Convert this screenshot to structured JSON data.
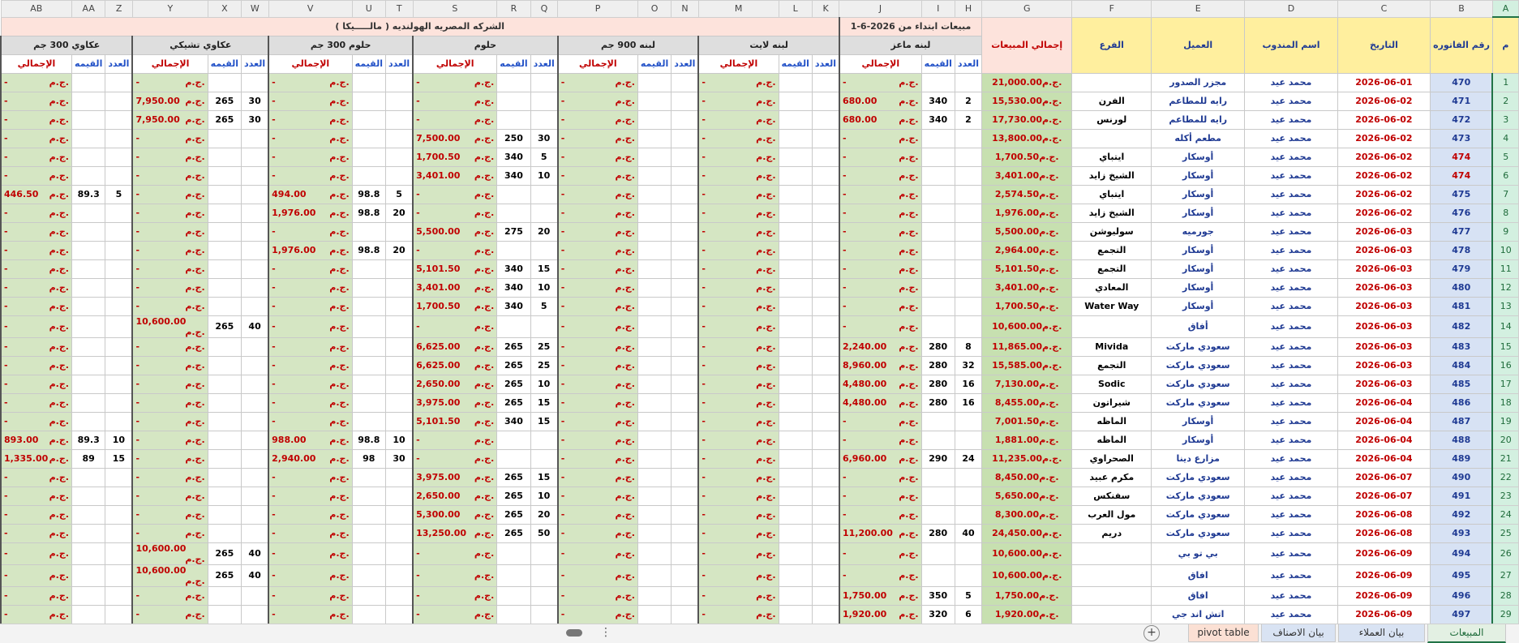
{
  "columns": [
    "AB",
    "AA",
    "Z",
    "Y",
    "X",
    "W",
    "V",
    "U",
    "T",
    "S",
    "R",
    "Q",
    "P",
    "O",
    "N",
    "M",
    "L",
    "K",
    "J",
    "I",
    "H",
    "G",
    "F",
    "E",
    "D",
    "C",
    "B",
    "A"
  ],
  "header": {
    "title": "الشركه المصريه الهولنديه ( مالـــــيكا )",
    "since": "مبيعات ابتداء من 2026-6-1",
    "total_sales": "إجمالي المبيعات",
    "branch": "الفرع",
    "customer": "العميل",
    "rep": "اسم المندوب",
    "date": "التاريخ",
    "invoice": "رقم الفاتوره",
    "num": "م",
    "products": [
      "عكاوي 300 جم",
      "عكاوي تشيكي",
      "حلوم 300 جم",
      "حلوم",
      "لبنه 900 جم",
      "لبنه لايت",
      "لبنه ماعز"
    ],
    "sub_total": "الإجمالي",
    "sub_price": "القيمه",
    "sub_count": "العدد"
  },
  "currency": "ج.م.",
  "dash": "-",
  "rows": [
    {
      "n": "1",
      "inv": "470",
      "date": "2026-06-01",
      "rep": "محمد عيد",
      "cust": "مجزر الصدور",
      "branch": "",
      "total": "21,000.00",
      "goat": [
        "",
        "",
        ""
      ],
      "light": [
        "",
        "",
        ""
      ],
      "l900": [
        "",
        "",
        ""
      ],
      "halloum": [
        "",
        "",
        ""
      ],
      "h300": [
        "",
        "",
        ""
      ],
      "czech": [
        "",
        "",
        ""
      ],
      "ak300": [
        "",
        "",
        ""
      ]
    },
    {
      "n": "2",
      "inv": "471",
      "date": "2026-06-02",
      "rep": "محمد عيد",
      "cust": "رايه للمطاعم",
      "branch": "الفرن",
      "total": "15,530.00",
      "goat": [
        "2",
        "340",
        "680.00"
      ],
      "light": [
        "",
        "",
        ""
      ],
      "l900": [
        "",
        "",
        ""
      ],
      "halloum": [
        "",
        "",
        ""
      ],
      "h300": [
        "",
        "",
        ""
      ],
      "czech": [
        "30",
        "265",
        "7,950.00"
      ],
      "ak300": [
        "",
        "",
        ""
      ]
    },
    {
      "n": "3",
      "inv": "472",
      "date": "2026-06-02",
      "rep": "محمد عيد",
      "cust": "رايه للمطاعم",
      "branch": "لورنس",
      "total": "17,730.00",
      "goat": [
        "2",
        "340",
        "680.00"
      ],
      "light": [
        "",
        "",
        ""
      ],
      "l900": [
        "",
        "",
        ""
      ],
      "halloum": [
        "",
        "",
        ""
      ],
      "h300": [
        "",
        "",
        ""
      ],
      "czech": [
        "30",
        "265",
        "7,950.00"
      ],
      "ak300": [
        "",
        "",
        ""
      ]
    },
    {
      "n": "4",
      "inv": "473",
      "date": "2026-06-02",
      "rep": "محمد عيد",
      "cust": "مطعم أكله",
      "branch": "",
      "total": "13,800.00",
      "goat": [
        "",
        "",
        ""
      ],
      "light": [
        "",
        "",
        ""
      ],
      "l900": [
        "",
        "",
        ""
      ],
      "halloum": [
        "30",
        "250",
        "7,500.00"
      ],
      "h300": [
        "",
        "",
        ""
      ],
      "czech": [
        "",
        "",
        ""
      ],
      "ak300": [
        "",
        "",
        ""
      ]
    },
    {
      "n": "5",
      "inv": "474",
      "date": "2026-06-02",
      "rep": "محمد عيد",
      "cust": "أوسكار",
      "branch": "ايتباي",
      "total": "1,700.50",
      "goat": [
        "",
        "",
        ""
      ],
      "light": [
        "",
        "",
        ""
      ],
      "l900": [
        "",
        "",
        ""
      ],
      "halloum": [
        "5",
        "340",
        "1,700.50"
      ],
      "h300": [
        "",
        "",
        ""
      ],
      "czech": [
        "",
        "",
        ""
      ],
      "ak300": [
        "",
        "",
        ""
      ]
    },
    {
      "n": "6",
      "inv": "474",
      "date": "2026-06-02",
      "rep": "محمد عيد",
      "cust": "أوسكار",
      "branch": "الشيخ زايد",
      "total": "3,401.00",
      "goat": [
        "",
        "",
        ""
      ],
      "light": [
        "",
        "",
        ""
      ],
      "l900": [
        "",
        "",
        ""
      ],
      "halloum": [
        "10",
        "340",
        "3,401.00"
      ],
      "h300": [
        "",
        "",
        ""
      ],
      "czech": [
        "",
        "",
        ""
      ],
      "ak300": [
        "",
        "",
        ""
      ]
    },
    {
      "n": "7",
      "inv": "475",
      "date": "2026-06-02",
      "rep": "محمد عيد",
      "cust": "أوسكار",
      "branch": "ايتباي",
      "total": "2,574.50",
      "goat": [
        "",
        "",
        ""
      ],
      "light": [
        "",
        "",
        ""
      ],
      "l900": [
        "",
        "",
        ""
      ],
      "halloum": [
        "",
        "",
        ""
      ],
      "h300": [
        "5",
        "98.8",
        "494.00"
      ],
      "czech": [
        "",
        "",
        ""
      ],
      "ak300": [
        "5",
        "89.3",
        "446.50"
      ]
    },
    {
      "n": "8",
      "inv": "476",
      "date": "2026-06-02",
      "rep": "محمد عيد",
      "cust": "أوسكار",
      "branch": "الشيخ زايد",
      "total": "1,976.00",
      "goat": [
        "",
        "",
        ""
      ],
      "light": [
        "",
        "",
        ""
      ],
      "l900": [
        "",
        "",
        ""
      ],
      "halloum": [
        "",
        "",
        ""
      ],
      "h300": [
        "20",
        "98.8",
        "1,976.00"
      ],
      "czech": [
        "",
        "",
        ""
      ],
      "ak300": [
        "",
        "",
        ""
      ]
    },
    {
      "n": "9",
      "inv": "477",
      "date": "2026-06-03",
      "rep": "محمد عيد",
      "cust": "جورميه",
      "branch": "سوليوشن",
      "total": "5,500.00",
      "goat": [
        "",
        "",
        ""
      ],
      "light": [
        "",
        "",
        ""
      ],
      "l900": [
        "",
        "",
        ""
      ],
      "halloum": [
        "20",
        "275",
        "5,500.00"
      ],
      "h300": [
        "",
        "",
        ""
      ],
      "czech": [
        "",
        "",
        ""
      ],
      "ak300": [
        "",
        "",
        ""
      ]
    },
    {
      "n": "10",
      "inv": "478",
      "date": "2026-06-03",
      "rep": "محمد عيد",
      "cust": "أوسكار",
      "branch": "التجمع",
      "total": "2,964.00",
      "goat": [
        "",
        "",
        ""
      ],
      "light": [
        "",
        "",
        ""
      ],
      "l900": [
        "",
        "",
        ""
      ],
      "halloum": [
        "",
        "",
        ""
      ],
      "h300": [
        "20",
        "98.8",
        "1,976.00"
      ],
      "czech": [
        "",
        "",
        ""
      ],
      "ak300": [
        "",
        "",
        ""
      ]
    },
    {
      "n": "11",
      "inv": "479",
      "date": "2026-06-03",
      "rep": "محمد عيد",
      "cust": "أوسكار",
      "branch": "التجمع",
      "total": "5,101.50",
      "goat": [
        "",
        "",
        ""
      ],
      "light": [
        "",
        "",
        ""
      ],
      "l900": [
        "",
        "",
        ""
      ],
      "halloum": [
        "15",
        "340",
        "5,101.50"
      ],
      "h300": [
        "",
        "",
        ""
      ],
      "czech": [
        "",
        "",
        ""
      ],
      "ak300": [
        "",
        "",
        ""
      ]
    },
    {
      "n": "12",
      "inv": "480",
      "date": "2026-06-03",
      "rep": "محمد عيد",
      "cust": "أوسكار",
      "branch": "المعادي",
      "total": "3,401.00",
      "goat": [
        "",
        "",
        ""
      ],
      "light": [
        "",
        "",
        ""
      ],
      "l900": [
        "",
        "",
        ""
      ],
      "halloum": [
        "10",
        "340",
        "3,401.00"
      ],
      "h300": [
        "",
        "",
        ""
      ],
      "czech": [
        "",
        "",
        ""
      ],
      "ak300": [
        "",
        "",
        ""
      ]
    },
    {
      "n": "13",
      "inv": "481",
      "date": "2026-06-03",
      "rep": "محمد عيد",
      "cust": "أوسكار",
      "branch": "Water Way",
      "total": "1,700.50",
      "goat": [
        "",
        "",
        ""
      ],
      "light": [
        "",
        "",
        ""
      ],
      "l900": [
        "",
        "",
        ""
      ],
      "halloum": [
        "5",
        "340",
        "1,700.50"
      ],
      "h300": [
        "",
        "",
        ""
      ],
      "czech": [
        "",
        "",
        ""
      ],
      "ak300": [
        "",
        "",
        ""
      ]
    },
    {
      "n": "14",
      "inv": "482",
      "date": "2026-06-03",
      "rep": "محمد عيد",
      "cust": "أفاق",
      "branch": "",
      "total": "10,600.00",
      "goat": [
        "",
        "",
        ""
      ],
      "light": [
        "",
        "",
        ""
      ],
      "l900": [
        "",
        "",
        ""
      ],
      "halloum": [
        "",
        "",
        ""
      ],
      "h300": [
        "",
        "",
        ""
      ],
      "czech": [
        "40",
        "265",
        "10,600.00"
      ],
      "ak300": [
        "",
        "",
        ""
      ]
    },
    {
      "n": "15",
      "inv": "483",
      "date": "2026-06-03",
      "rep": "محمد عيد",
      "cust": "سعودي ماركت",
      "branch": "Mivida",
      "total": "11,865.00",
      "goat": [
        "8",
        "280",
        "2,240.00"
      ],
      "light": [
        "",
        "",
        ""
      ],
      "l900": [
        "",
        "",
        ""
      ],
      "halloum": [
        "25",
        "265",
        "6,625.00"
      ],
      "h300": [
        "",
        "",
        ""
      ],
      "czech": [
        "",
        "",
        ""
      ],
      "ak300": [
        "",
        "",
        ""
      ]
    },
    {
      "n": "16",
      "inv": "484",
      "date": "2026-06-03",
      "rep": "محمد عيد",
      "cust": "سعودي ماركت",
      "branch": "التجمع",
      "total": "15,585.00",
      "goat": [
        "32",
        "280",
        "8,960.00"
      ],
      "light": [
        "",
        "",
        ""
      ],
      "l900": [
        "",
        "",
        ""
      ],
      "halloum": [
        "25",
        "265",
        "6,625.00"
      ],
      "h300": [
        "",
        "",
        ""
      ],
      "czech": [
        "",
        "",
        ""
      ],
      "ak300": [
        "",
        "",
        ""
      ]
    },
    {
      "n": "17",
      "inv": "485",
      "date": "2026-06-03",
      "rep": "محمد عيد",
      "cust": "سعودي ماركت",
      "branch": "Sodic",
      "total": "7,130.00",
      "goat": [
        "16",
        "280",
        "4,480.00"
      ],
      "light": [
        "",
        "",
        ""
      ],
      "l900": [
        "",
        "",
        ""
      ],
      "halloum": [
        "10",
        "265",
        "2,650.00"
      ],
      "h300": [
        "",
        "",
        ""
      ],
      "czech": [
        "",
        "",
        ""
      ],
      "ak300": [
        "",
        "",
        ""
      ]
    },
    {
      "n": "18",
      "inv": "486",
      "date": "2026-06-04",
      "rep": "محمد عيد",
      "cust": "سعودي ماركت",
      "branch": "شيراتون",
      "total": "8,455.00",
      "goat": [
        "16",
        "280",
        "4,480.00"
      ],
      "light": [
        "",
        "",
        ""
      ],
      "l900": [
        "",
        "",
        ""
      ],
      "halloum": [
        "15",
        "265",
        "3,975.00"
      ],
      "h300": [
        "",
        "",
        ""
      ],
      "czech": [
        "",
        "",
        ""
      ],
      "ak300": [
        "",
        "",
        ""
      ]
    },
    {
      "n": "19",
      "inv": "487",
      "date": "2026-06-04",
      "rep": "محمد عيد",
      "cust": "أوسكار",
      "branch": "الماظه",
      "total": "7,001.50",
      "goat": [
        "",
        "",
        ""
      ],
      "light": [
        "",
        "",
        ""
      ],
      "l900": [
        "",
        "",
        ""
      ],
      "halloum": [
        "15",
        "340",
        "5,101.50"
      ],
      "h300": [
        "",
        "",
        ""
      ],
      "czech": [
        "",
        "",
        ""
      ],
      "ak300": [
        "",
        "",
        ""
      ]
    },
    {
      "n": "20",
      "inv": "488",
      "date": "2026-06-04",
      "rep": "محمد عيد",
      "cust": "أوسكار",
      "branch": "الماظه",
      "total": "1,881.00",
      "goat": [
        "",
        "",
        ""
      ],
      "light": [
        "",
        "",
        ""
      ],
      "l900": [
        "",
        "",
        ""
      ],
      "halloum": [
        "",
        "",
        ""
      ],
      "h300": [
        "10",
        "98.8",
        "988.00"
      ],
      "czech": [
        "",
        "",
        ""
      ],
      "ak300": [
        "10",
        "89.3",
        "893.00"
      ]
    },
    {
      "n": "21",
      "inv": "489",
      "date": "2026-06-04",
      "rep": "محمد عيد",
      "cust": "مزارع دينا",
      "branch": "الصحراوي",
      "total": "11,235.00",
      "goat": [
        "24",
        "290",
        "6,960.00"
      ],
      "light": [
        "",
        "",
        ""
      ],
      "l900": [
        "",
        "",
        ""
      ],
      "halloum": [
        "",
        "",
        ""
      ],
      "h300": [
        "30",
        "98",
        "2,940.00"
      ],
      "czech": [
        "",
        "",
        ""
      ],
      "ak300": [
        "15",
        "89",
        "1,335.00"
      ]
    },
    {
      "n": "22",
      "inv": "490",
      "date": "2026-06-07",
      "rep": "محمد عيد",
      "cust": "سعودي ماركت",
      "branch": "مكرم عبيد",
      "total": "8,450.00",
      "goat": [
        "",
        "",
        ""
      ],
      "light": [
        "",
        "",
        ""
      ],
      "l900": [
        "",
        "",
        ""
      ],
      "halloum": [
        "15",
        "265",
        "3,975.00"
      ],
      "h300": [
        "",
        "",
        ""
      ],
      "czech": [
        "",
        "",
        ""
      ],
      "ak300": [
        "",
        "",
        ""
      ]
    },
    {
      "n": "23",
      "inv": "491",
      "date": "2026-06-07",
      "rep": "محمد عيد",
      "cust": "سعودي ماركت",
      "branch": "سفنكس",
      "total": "5,650.00",
      "goat": [
        "",
        "",
        ""
      ],
      "light": [
        "",
        "",
        ""
      ],
      "l900": [
        "",
        "",
        ""
      ],
      "halloum": [
        "10",
        "265",
        "2,650.00"
      ],
      "h300": [
        "",
        "",
        ""
      ],
      "czech": [
        "",
        "",
        ""
      ],
      "ak300": [
        "",
        "",
        ""
      ]
    },
    {
      "n": "24",
      "inv": "492",
      "date": "2026-06-08",
      "rep": "محمد عيد",
      "cust": "سعودي ماركت",
      "branch": "مول العرب",
      "total": "8,300.00",
      "goat": [
        "",
        "",
        ""
      ],
      "light": [
        "",
        "",
        ""
      ],
      "l900": [
        "",
        "",
        ""
      ],
      "halloum": [
        "20",
        "265",
        "5,300.00"
      ],
      "h300": [
        "",
        "",
        ""
      ],
      "czech": [
        "",
        "",
        ""
      ],
      "ak300": [
        "",
        "",
        ""
      ]
    },
    {
      "n": "25",
      "inv": "493",
      "date": "2026-06-08",
      "rep": "محمد عيد",
      "cust": "سعودي ماركت",
      "branch": "دريم",
      "total": "24,450.00",
      "goat": [
        "40",
        "280",
        "11,200.00"
      ],
      "light": [
        "",
        "",
        ""
      ],
      "l900": [
        "",
        "",
        ""
      ],
      "halloum": [
        "50",
        "265",
        "13,250.00"
      ],
      "h300": [
        "",
        "",
        ""
      ],
      "czech": [
        "",
        "",
        ""
      ],
      "ak300": [
        "",
        "",
        ""
      ]
    },
    {
      "n": "26",
      "inv": "494",
      "date": "2026-06-09",
      "rep": "محمد عيد",
      "cust": "بي تو بي",
      "branch": "",
      "total": "10,600.00",
      "goat": [
        "",
        "",
        ""
      ],
      "light": [
        "",
        "",
        ""
      ],
      "l900": [
        "",
        "",
        ""
      ],
      "halloum": [
        "",
        "",
        ""
      ],
      "h300": [
        "",
        "",
        ""
      ],
      "czech": [
        "40",
        "265",
        "10,600.00"
      ],
      "ak300": [
        "",
        "",
        ""
      ]
    },
    {
      "n": "27",
      "inv": "495",
      "date": "2026-06-09",
      "rep": "محمد عيد",
      "cust": "افاق",
      "branch": "",
      "total": "10,600.00",
      "goat": [
        "",
        "",
        ""
      ],
      "light": [
        "",
        "",
        ""
      ],
      "l900": [
        "",
        "",
        ""
      ],
      "halloum": [
        "",
        "",
        ""
      ],
      "h300": [
        "",
        "",
        ""
      ],
      "czech": [
        "40",
        "265",
        "10,600.00"
      ],
      "ak300": [
        "",
        "",
        ""
      ]
    },
    {
      "n": "28",
      "inv": "496",
      "date": "2026-06-09",
      "rep": "محمد عيد",
      "cust": "افاق",
      "branch": "",
      "total": "1,750.00",
      "goat": [
        "5",
        "350",
        "1,750.00"
      ],
      "light": [
        "",
        "",
        ""
      ],
      "l900": [
        "",
        "",
        ""
      ],
      "halloum": [
        "",
        "",
        ""
      ],
      "h300": [
        "",
        "",
        ""
      ],
      "czech": [
        "",
        "",
        ""
      ],
      "ak300": [
        "",
        "",
        ""
      ]
    },
    {
      "n": "29",
      "inv": "497",
      "date": "2026-06-09",
      "rep": "محمد عيد",
      "cust": "اتش اند جي",
      "branch": "",
      "total": "1,920.00",
      "goat": [
        "6",
        "320",
        "1,920.00"
      ],
      "light": [
        "",
        "",
        ""
      ],
      "l900": [
        "",
        "",
        ""
      ],
      "halloum": [
        "",
        "",
        ""
      ],
      "h300": [
        "",
        "",
        ""
      ],
      "czech": [
        "",
        "",
        ""
      ],
      "ak300": [
        "",
        "",
        ""
      ]
    }
  ],
  "sheet_tabs": {
    "sales": "المبيعات",
    "customers": "بيان العملاء",
    "items": "بيان الاصناف",
    "pivot": "pivot table"
  }
}
